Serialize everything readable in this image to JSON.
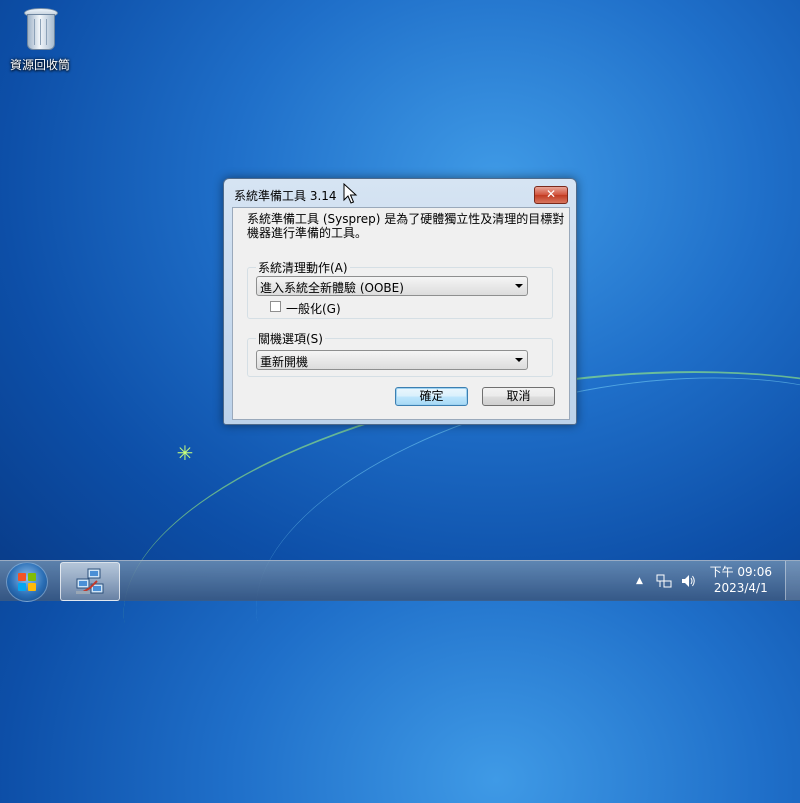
{
  "desktop": {
    "icons": [
      {
        "label": "資源回收筒",
        "icon": "recycle-bin-icon"
      }
    ]
  },
  "dialog": {
    "title": "系統準備工具 3.14",
    "close_glyph": "✕",
    "description": "系統準備工具 (Sysprep) 是為了硬體獨立性及清理的目標對機器進行準備的工具。",
    "cleanup_group": {
      "label": "系統清理動作(A)",
      "selected": "進入系統全新體驗 (OOBE)",
      "generalize_label": "一般化(G)",
      "generalize_checked": false
    },
    "shutdown_group": {
      "label": "關機選項(S)",
      "selected": "重新開機"
    },
    "ok_label": "確定",
    "cancel_label": "取消"
  },
  "taskbar": {
    "start_icon": "windows-logo-icon",
    "pinned": [
      {
        "icon": "network-computers-icon"
      }
    ],
    "tray": {
      "arrow": "▲",
      "time": "下午 09:06",
      "date": "2023/4/1"
    }
  },
  "colors": {
    "desktop_accent": "#1f6fc9",
    "close_button": "#c13b22",
    "default_button_border": "#3c7fb1"
  }
}
